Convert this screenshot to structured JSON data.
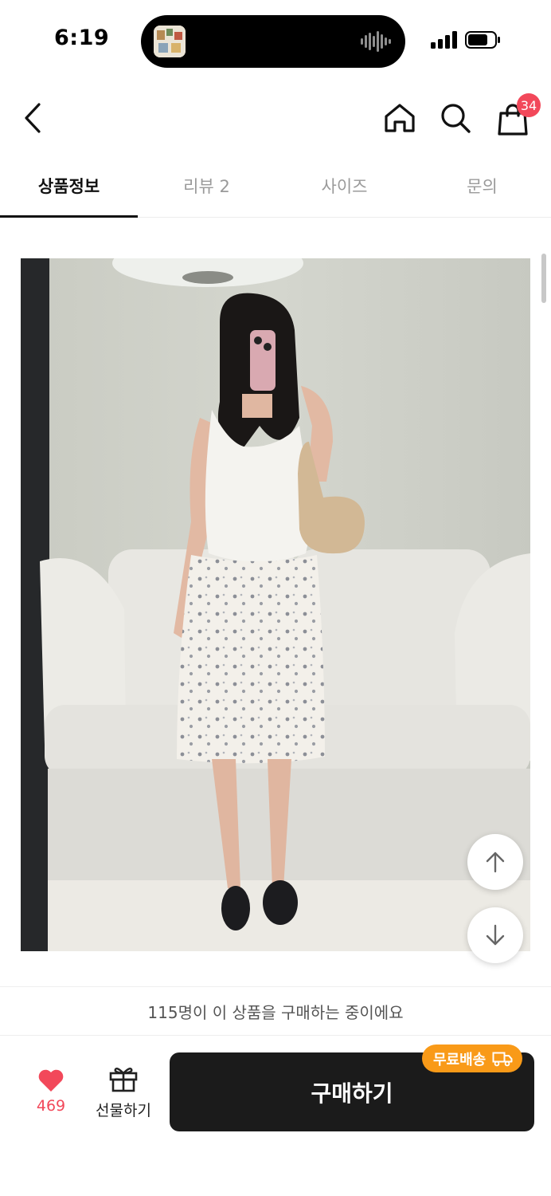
{
  "status_bar": {
    "time": "6:19"
  },
  "nav": {
    "cart_count": "34"
  },
  "tabs": [
    {
      "label": "상품정보",
      "active": true
    },
    {
      "label": "리뷰 2",
      "active": false
    },
    {
      "label": "사이즈",
      "active": false
    },
    {
      "label": "문의",
      "active": false
    }
  ],
  "product": {
    "image_alt": "product-photo"
  },
  "notice": {
    "text": "115명이 이 상품을 구매하는 중이에요"
  },
  "bottom_bar": {
    "like_count": "469",
    "gift_label": "선물하기",
    "buy_label": "구매하기",
    "free_shipping_badge": "무료배송"
  },
  "colors": {
    "accent_red": "#f2485a",
    "badge_orange": "#f99a18",
    "buy_button": "#1b1b1b"
  },
  "icons": [
    "back-chevron-icon",
    "home-icon",
    "search-icon",
    "shopping-bag-icon",
    "heart-icon",
    "gift-icon",
    "truck-icon",
    "arrow-up-icon",
    "arrow-down-icon"
  ]
}
